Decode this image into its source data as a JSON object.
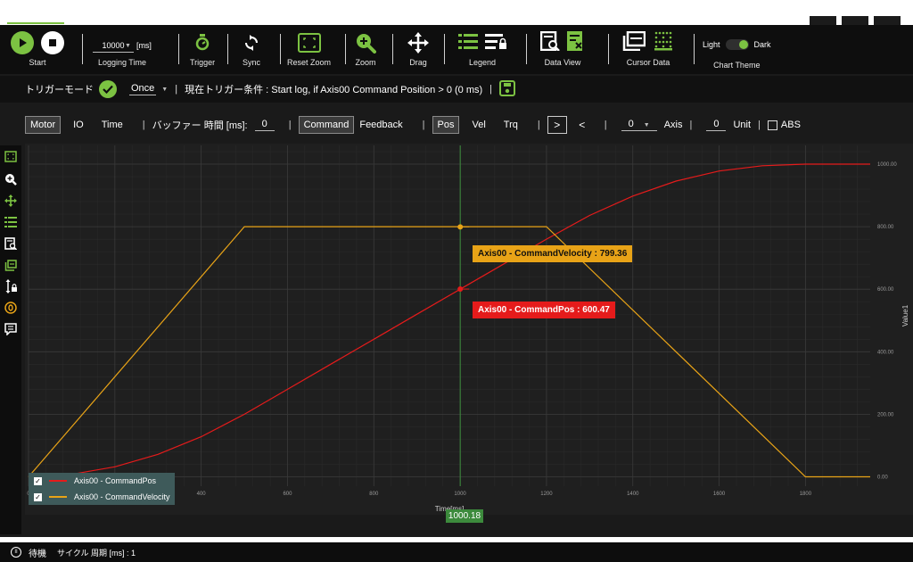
{
  "toolbar": {
    "start_label": "Start",
    "logging_time_value": "10000",
    "logging_time_unit": "[ms]",
    "logging_time_label": "Logging Time",
    "trigger_label": "Trigger",
    "sync_label": "Sync",
    "reset_zoom_label": "Reset Zoom",
    "zoom_label": "Zoom",
    "drag_label": "Drag",
    "legend_label": "Legend",
    "data_view_label": "Data View",
    "cursor_data_label": "Cursor Data",
    "theme_light": "Light",
    "theme_dark": "Dark",
    "chart_theme_label": "Chart Theme"
  },
  "trigger_row": {
    "mode_label": "トリガーモード",
    "mode_value": "Once",
    "condition_text": "現在トリガー条件 : Start log, if Axis00 Command Position > 0 (0 ms)"
  },
  "options_row": {
    "motor": "Motor",
    "io": "IO",
    "time": "Time",
    "buffer_label": "バッファー 時間 [ms]:",
    "buffer_value": "0",
    "command": "Command",
    "feedback": "Feedback",
    "pos": "Pos",
    "vel": "Vel",
    "trq": "Trq",
    "next": ">",
    "prev": "<",
    "axis_value": "0",
    "axis_label": "Axis",
    "unit_value": "0",
    "unit_label": "Unit",
    "abs_label": "ABS"
  },
  "colors": {
    "accent": "#7cc242",
    "pos_series": "#e51b1b",
    "vel_series": "#e8a317",
    "background": "#1a1a1a"
  },
  "chart_data": {
    "type": "line",
    "xlabel": "Time[ms]",
    "ylabel": "Value1",
    "xlim": [
      0,
      1950
    ],
    "ylim": [
      -30,
      1060
    ],
    "x_ticks": [
      "0",
      "200",
      "400",
      "600",
      "800",
      "1000",
      "1200",
      "1400",
      "1600",
      "1800"
    ],
    "y_ticks": [
      "0.00",
      "200.00",
      "400.00",
      "600.00",
      "800.00",
      "1000.00"
    ],
    "series": [
      {
        "name": "Axis00 - CommandPos",
        "color": "#e51b1b",
        "x": [
          0,
          100,
          200,
          300,
          400,
          500,
          600,
          700,
          800,
          900,
          1000,
          1100,
          1200,
          1300,
          1400,
          1500,
          1600,
          1700,
          1800,
          1900,
          1950
        ],
        "values": [
          0,
          8,
          32,
          72,
          128,
          200,
          280,
          360,
          440,
          520,
          600,
          680,
          760,
          836,
          898,
          946,
          978,
          995,
          1000,
          1000,
          1000
        ]
      },
      {
        "name": "Axis00 - CommandVelocity",
        "color": "#e8a317",
        "x": [
          0,
          500,
          1200,
          1800,
          1950
        ],
        "values": [
          0,
          800,
          800,
          0,
          0
        ]
      }
    ],
    "cursor": {
      "x_label": "1000.18",
      "x": 1000.18,
      "points": [
        {
          "series": "Axis00 - CommandVelocity",
          "y": 799.36,
          "text": "Axis00 - CommandVelocity : 799.36"
        },
        {
          "series": "Axis00 - CommandPos",
          "y": 600.47,
          "text": "Axis00 - CommandPos : 600.47"
        }
      ]
    },
    "legend": {
      "position": "bottom-left",
      "entries": [
        "Axis00 - CommandPos",
        "Axis00 - CommandVelocity"
      ]
    },
    "grid": true
  },
  "status_bar": {
    "state": "待機",
    "cycle_label": "サイクル 周期 [ms] : 1"
  },
  "side_icons": [
    "fit-icon",
    "zoom-icon",
    "drag-icon",
    "legend-icon",
    "data-view-icon",
    "cursor-data-icon",
    "axis-lock-icon",
    "zero-icon",
    "comment-icon"
  ]
}
